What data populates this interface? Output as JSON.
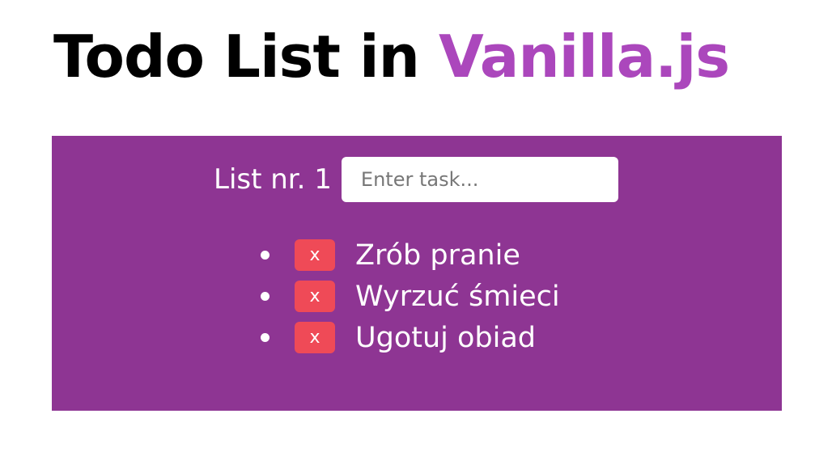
{
  "header": {
    "title_main": "Todo List in ",
    "title_accent": "Vanilla.js"
  },
  "todo": {
    "list_label": "List nr. 1",
    "input": {
      "value": "",
      "placeholder": "Enter task..."
    },
    "delete_label": "x",
    "items": [
      {
        "text": "Zrób pranie"
      },
      {
        "text": "Wyrzuć śmieci"
      },
      {
        "text": "Ugotuj obiad"
      }
    ]
  },
  "colors": {
    "accent": "#ab47bc",
    "panel_background": "#8e3593",
    "delete_button": "#ef4a57",
    "text_light": "#ffffff"
  }
}
